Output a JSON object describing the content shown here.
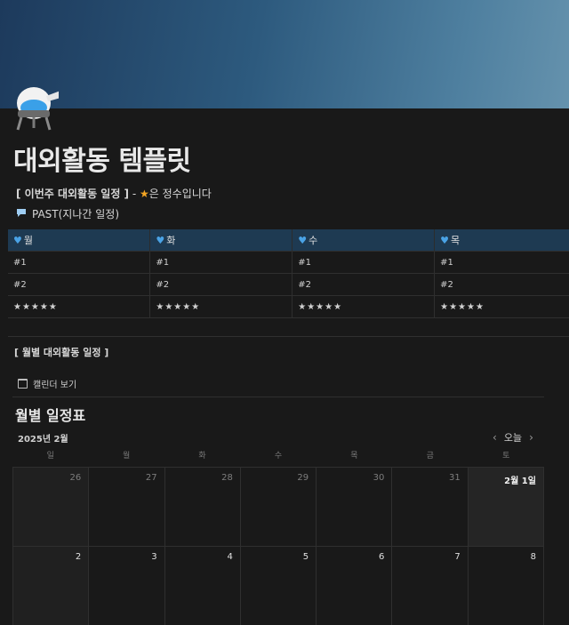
{
  "page": {
    "title": "대외활동 템플릿",
    "line1_bold": "[ 이번주 대외활동 일정 ]",
    "line1_sep": " - ",
    "line1_star": "★",
    "line1_rest": "은 정수입니다",
    "line2": "PAST(지나간 일정)"
  },
  "weekly_table": {
    "headers": [
      "월",
      "화",
      "수",
      "목"
    ],
    "rows": [
      [
        "#1",
        "#1",
        "#1",
        "#1"
      ],
      [
        "#2",
        "#2",
        "#2",
        "#2"
      ],
      [
        "★★★★★",
        "★★★★★",
        "★★★★★",
        "★★★★★"
      ]
    ]
  },
  "monthly": {
    "heading": "[ 월별 대외활동 일정 ]",
    "view_label": "캘린더 보기",
    "calendar_title": "월별 일정표",
    "month": "2025년 2월",
    "today_label": "오늘",
    "prev": "‹",
    "next": "›",
    "weekdays": [
      "일",
      "월",
      "화",
      "수",
      "목",
      "금",
      "토"
    ],
    "weeks": [
      [
        "26",
        "27",
        "28",
        "29",
        "30",
        "31",
        "2월 1일"
      ],
      [
        "2",
        "3",
        "4",
        "5",
        "6",
        "7",
        "8"
      ]
    ]
  },
  "colors": {
    "background": "#191919",
    "table_header": "#1e3a52",
    "heart": "#4aa3e6",
    "star": "#f5a623"
  },
  "icons": {
    "page_icon": "crystal-ball-icon",
    "comment": "speech-bubble-icon",
    "heart": "blue-heart-icon",
    "calendar": "calendar-icon"
  }
}
